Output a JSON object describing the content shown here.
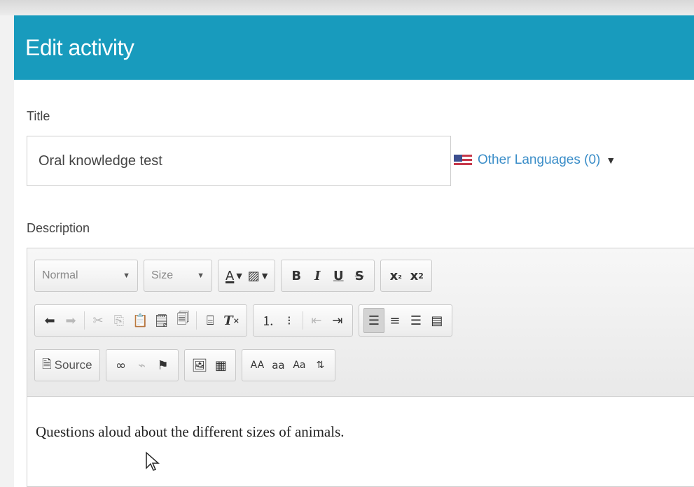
{
  "header": {
    "title": "Edit activity"
  },
  "form": {
    "title_label": "Title",
    "title_value": "Oral knowledge test",
    "other_languages": "Other Languages (0)",
    "description_label": "Description"
  },
  "toolbar": {
    "format_value": "Normal",
    "size_value": "Size",
    "text_color_glyph": "A",
    "bg_color_glyph": "▨",
    "bold": "B",
    "italic": "I",
    "underline": "U",
    "strike": "S",
    "subscript": "x",
    "superscript": "x",
    "source_label": "Source",
    "uppercase": "AA",
    "lowercase": "aa",
    "titlecase": "Aa"
  },
  "editor": {
    "content": "Questions aloud about the different sizes of animals."
  },
  "colors": {
    "header_bg": "#189bbd",
    "link": "#3a8dc8"
  },
  "icons": [
    "flag-icon",
    "caret-down-icon",
    "undo-icon",
    "redo-icon",
    "cut-icon",
    "copy-icon",
    "paste-icon",
    "paste-text-icon",
    "paste-word-icon",
    "format-painter-icon",
    "remove-format-icon",
    "numbered-list-icon",
    "bulleted-list-icon",
    "decrease-indent-icon",
    "increase-indent-icon",
    "align-left-icon",
    "align-center-icon",
    "align-right-icon",
    "justify-icon",
    "source-icon",
    "link-icon",
    "unlink-icon",
    "anchor-icon",
    "image-icon",
    "table-icon",
    "toggle-case-icon",
    "mouse-pointer-icon"
  ]
}
